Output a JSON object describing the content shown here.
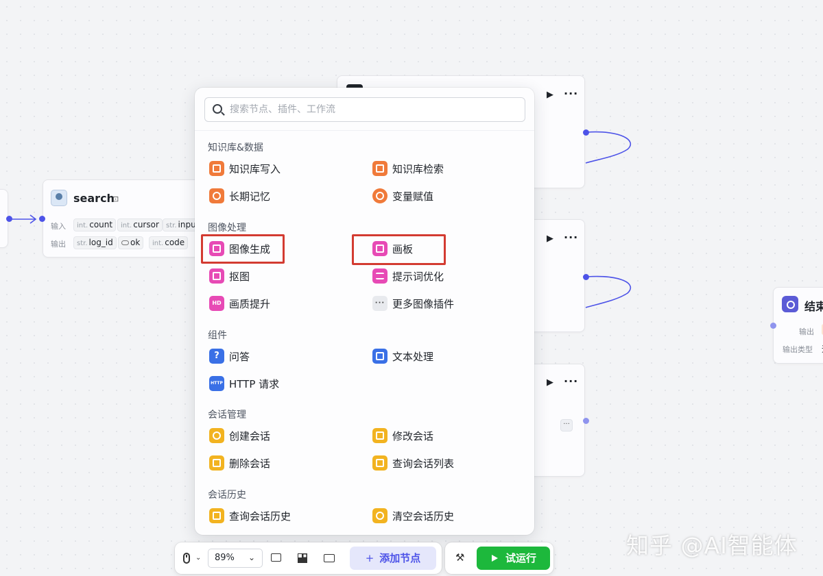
{
  "search_node": {
    "title": "search",
    "input_label": "输入",
    "output_label": "输出",
    "inputs": [
      {
        "type": "int.",
        "name": "count"
      },
      {
        "type": "int.",
        "name": "cursor"
      },
      {
        "type": "str.",
        "name": "inpu"
      }
    ],
    "outputs": [
      {
        "type": "str.",
        "name": "log_id"
      },
      {
        "type": "",
        "name": "ok"
      },
      {
        "type": "int.",
        "name": "code"
      }
    ]
  },
  "end_node": {
    "title": "结束",
    "output_label": "输出",
    "output_type_label": "输出类型",
    "output_type_value": "追"
  },
  "node_menu": {
    "more_glyph": "···",
    "mini_more_glyph": "···"
  },
  "panel": {
    "search_placeholder": "搜索节点、插件、工作流",
    "sections": [
      {
        "title": "知识库&数据",
        "items": [
          {
            "label": "知识库写入",
            "icon": "knowledge-write-icon",
            "color": "orange"
          },
          {
            "label": "知识库检索",
            "icon": "knowledge-search-icon",
            "color": "orange"
          },
          {
            "label": "长期记忆",
            "icon": "long-term-memory-icon",
            "color": "orange"
          },
          {
            "label": "变量赋值",
            "icon": "variable-assign-icon",
            "color": "orange"
          }
        ]
      },
      {
        "title": "图像处理",
        "items": [
          {
            "label": "图像生成",
            "icon": "image-generate-icon",
            "color": "pink"
          },
          {
            "label": "画板",
            "icon": "canvas-board-icon",
            "color": "pink"
          },
          {
            "label": "抠图",
            "icon": "cutout-icon",
            "color": "pink"
          },
          {
            "label": "提示词优化",
            "icon": "prompt-optimize-icon",
            "color": "pink"
          },
          {
            "label": "画质提升",
            "icon": "hd-enhance-icon",
            "color": "pink",
            "glyph": "HD"
          },
          {
            "label": "更多图像插件",
            "icon": "more-icon",
            "color": "grey",
            "glyph": "···"
          }
        ]
      },
      {
        "title": "组件",
        "items": [
          {
            "label": "问答",
            "icon": "qa-icon",
            "color": "blue",
            "glyph": "?"
          },
          {
            "label": "文本处理",
            "icon": "text-process-icon",
            "color": "blue"
          },
          {
            "label": "HTTP 请求",
            "icon": "http-icon",
            "color": "blue",
            "glyph": "HTTP"
          }
        ]
      },
      {
        "title": "会话管理",
        "items": [
          {
            "label": "创建会话",
            "icon": "create-conversation-icon",
            "color": "yellow"
          },
          {
            "label": "修改会话",
            "icon": "edit-conversation-icon",
            "color": "yellow"
          },
          {
            "label": "删除会话",
            "icon": "delete-conversation-icon",
            "color": "yellow"
          },
          {
            "label": "查询会话列表",
            "icon": "list-conversation-icon",
            "color": "yellow"
          }
        ]
      },
      {
        "title": "会话历史",
        "items": [
          {
            "label": "查询会话历史",
            "icon": "query-history-icon",
            "color": "yellow"
          },
          {
            "label": "清空会话历史",
            "icon": "clear-history-icon",
            "color": "yellow"
          }
        ]
      }
    ]
  },
  "toolbar": {
    "zoom": "89%",
    "add_node_label": "添加节点",
    "add_node_plus": "+",
    "run_label": "试运行"
  },
  "watermark": "知乎 @AI智能体",
  "colors": {
    "accent": "#4d53e8",
    "run_green": "#1db83c",
    "highlight_red": "#d33b31",
    "orange": "#f07a3a",
    "pink": "#e74ab5",
    "blue": "#3a70e6",
    "yellow": "#f2b320"
  }
}
